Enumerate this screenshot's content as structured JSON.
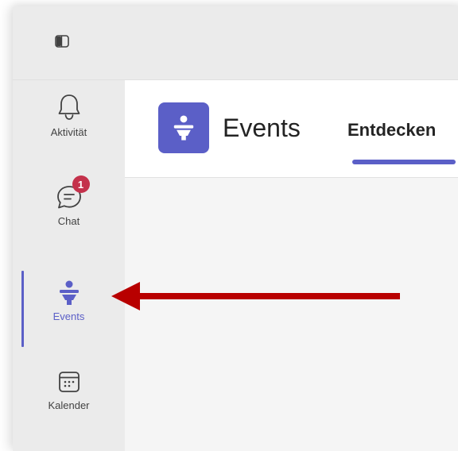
{
  "topbar": {
    "toggle_icon": "sidebar-toggle-icon"
  },
  "rail": {
    "items": [
      {
        "label": "Aktivität",
        "icon": "bell-icon"
      },
      {
        "label": "Chat",
        "icon": "chat-icon",
        "badge": "1"
      },
      {
        "label": "Events",
        "icon": "events-icon",
        "active": true
      },
      {
        "label": "Kalender",
        "icon": "calendar-icon"
      }
    ]
  },
  "header": {
    "title": "Events",
    "tabs": [
      {
        "label": "Entdecken",
        "selected": true
      }
    ]
  },
  "colors": {
    "accent": "#5b5fc7",
    "badge": "#c4314b",
    "annotation_arrow": "#b80000"
  }
}
